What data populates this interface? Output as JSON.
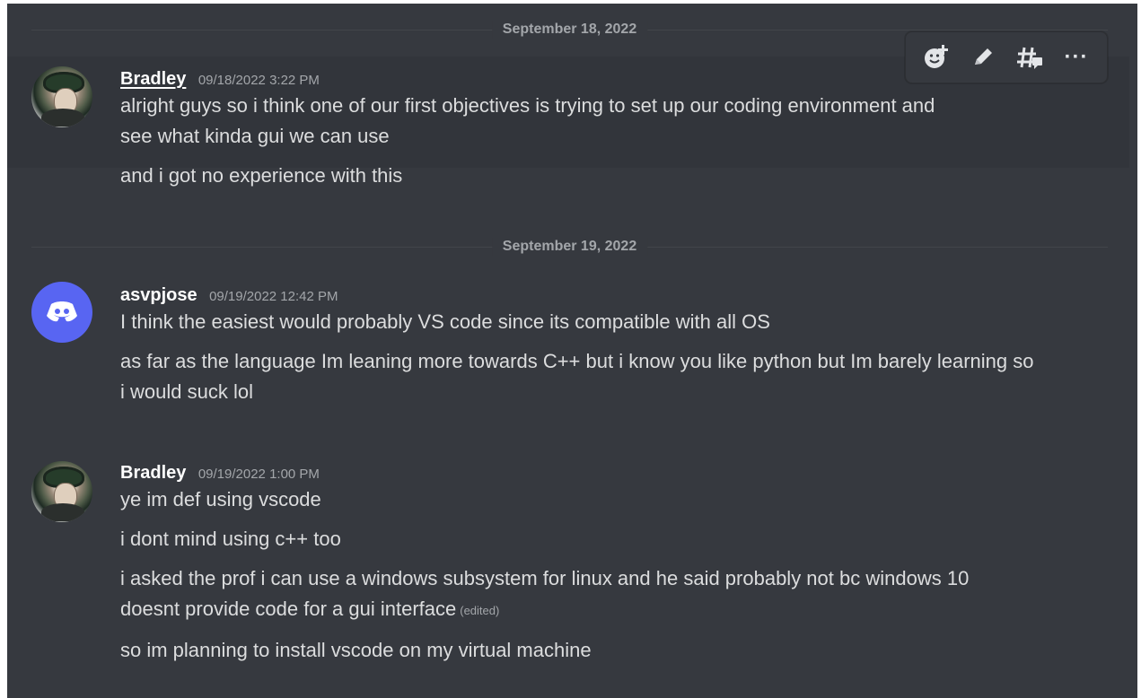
{
  "date_dividers": [
    {
      "label": "September 18, 2022"
    },
    {
      "label": "September 19, 2022"
    }
  ],
  "messages": [
    {
      "author": "Bradley",
      "timestamp": "09/18/2022 3:22 PM",
      "lines": [
        "alright guys so i think one of our first objectives is trying to set up our coding environment and see what kinda gui we can use",
        "and i got no experience with this"
      ]
    },
    {
      "author": "asvpjose",
      "timestamp": "09/19/2022 12:42 PM",
      "lines": [
        "I think the easiest would probably VS code since its compatible with all OS",
        "as far as the language Im leaning more towards C++ but i know you like python but Im barely learning so i would suck lol"
      ]
    },
    {
      "author": "Bradley",
      "timestamp": "09/19/2022 1:00 PM",
      "lines": [
        "ye im def using vscode",
        "i dont mind using c++ too",
        "i asked the prof i can use a windows subsystem for linux and he said probably not bc windows 10 doesnt provide code for a gui interface",
        "so im planning to install vscode on my virtual machine"
      ],
      "edited_label": "(edited)"
    }
  ],
  "toolbar": {
    "actions": [
      {
        "icon": "add-reaction-icon"
      },
      {
        "icon": "pencil-icon"
      },
      {
        "icon": "create-thread-icon"
      },
      {
        "icon": "more-icon",
        "label": "···"
      }
    ]
  },
  "colors": {
    "background": "#36393f",
    "hover_background": "#32353b",
    "divider": "#42454a",
    "accent": "#5865f2",
    "text_primary": "#dcddde",
    "text_muted": "#a3a6aa"
  }
}
